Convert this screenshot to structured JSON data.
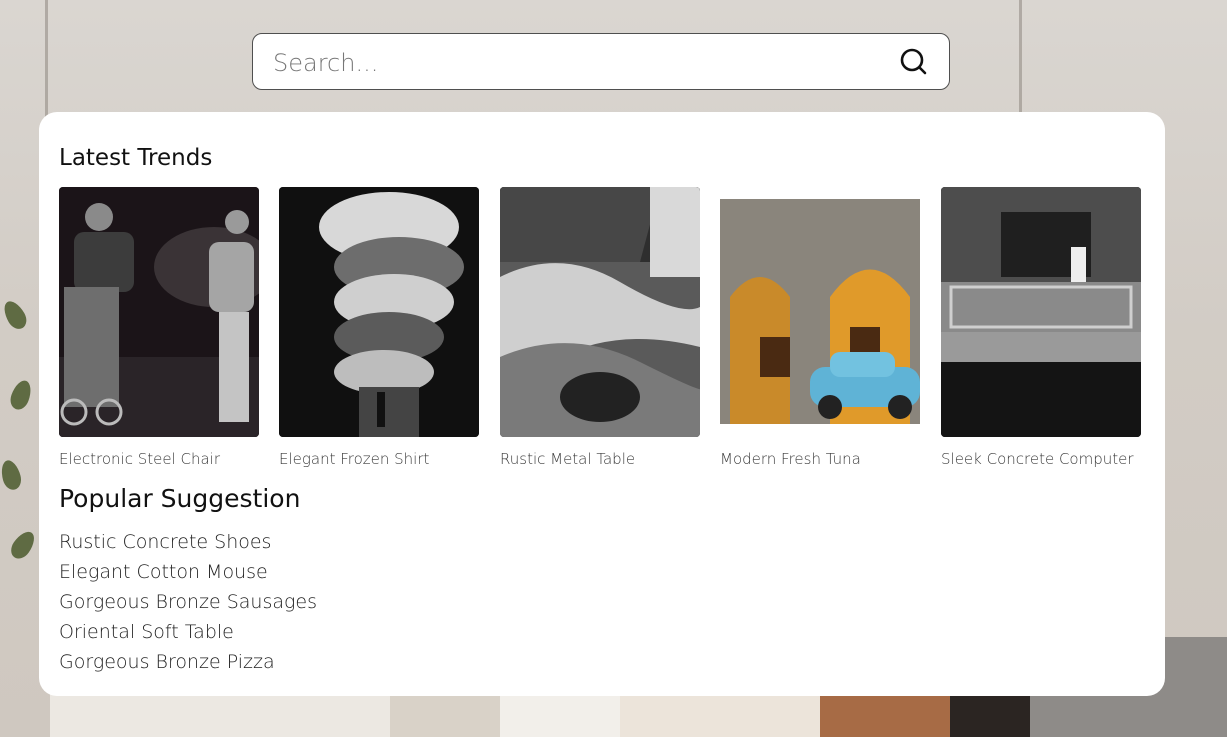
{
  "search": {
    "placeholder": "Search...",
    "icon": "search-icon"
  },
  "trends": {
    "title": "Latest Trends",
    "items": [
      {
        "label": "Electronic Steel Chair"
      },
      {
        "label": "Elegant Frozen Shirt"
      },
      {
        "label": "Rustic Metal Table"
      },
      {
        "label": "Modern Fresh Tuna"
      },
      {
        "label": "Sleek Concrete Computer"
      }
    ]
  },
  "suggestions": {
    "title": "Popular Suggestion",
    "items": [
      {
        "label": "Rustic Concrete Shoes"
      },
      {
        "label": "Elegant Cotton Mouse"
      },
      {
        "label": "Gorgeous Bronze Sausages"
      },
      {
        "label": "Oriental Soft Table"
      },
      {
        "label": "Gorgeous Bronze Pizza"
      }
    ]
  },
  "colors": {
    "panel_bg": "#ffffff",
    "search_border": "#4f4f4f",
    "accent_car": "#5fb3d6"
  }
}
